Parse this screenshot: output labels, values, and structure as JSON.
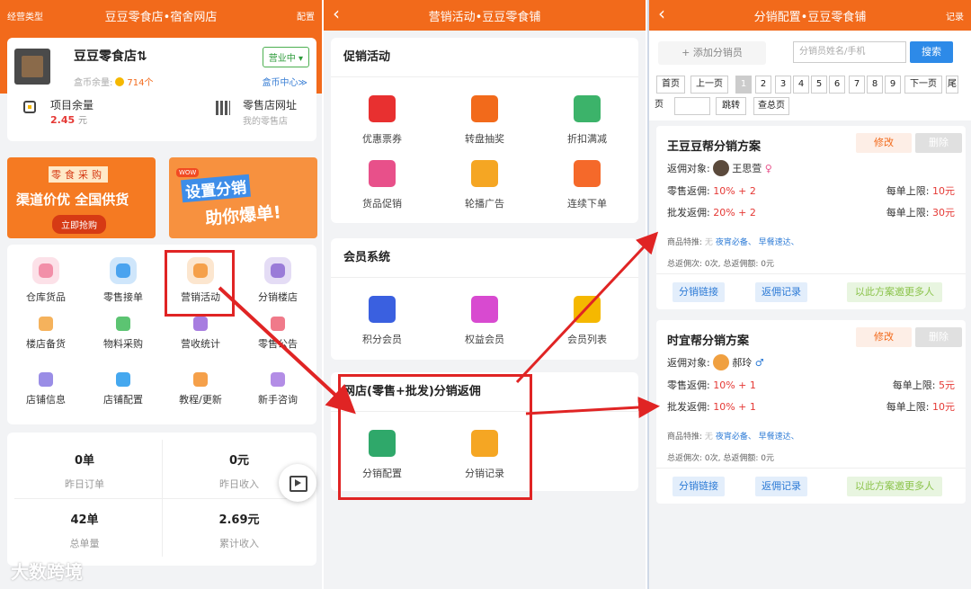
{
  "panel1": {
    "header": {
      "left": "经营类型",
      "title": "豆豆零食店•宿舍网店",
      "right": "配置"
    },
    "store": {
      "name": "豆豆零食店⇅",
      "status": "营业中 ▾",
      "coin_label": "盒币余量:",
      "coin_value": "714个",
      "coin_center": "盒币中心≫",
      "proj_label": "项目余量",
      "proj_value": "2.45",
      "proj_unit": "元",
      "url_label": "零售店网址",
      "url_sub": "我的零售店"
    },
    "banner1": {
      "tag": "零食采购",
      "big": "渠道价优 全国供货",
      "btn": "立即抢购"
    },
    "banner2": {
      "wow": "WOW",
      "line1": "设置分销",
      "line2": "助你爆单!"
    },
    "grid": [
      {
        "label": "仓库货品",
        "color": "#f28fa8"
      },
      {
        "label": "零售接单",
        "color": "#4aa3ef"
      },
      {
        "label": "营销活动",
        "color": "#f5a04a"
      },
      {
        "label": "分销楼店",
        "color": "#9a7bd8"
      },
      {
        "label": "楼店备货",
        "color": "#f5b25c"
      },
      {
        "label": "物料采购",
        "color": "#5cc472"
      },
      {
        "label": "营收统计",
        "color": "#a77de0"
      },
      {
        "label": "零售公告",
        "color": "#f07a8a"
      },
      {
        "label": "店铺信息",
        "color": "#9a8de6"
      },
      {
        "label": "店铺配置",
        "color": "#45a8ef"
      },
      {
        "label": "教程/更新",
        "color": "#f5a04a"
      },
      {
        "label": "新手咨询",
        "color": "#b38de6"
      }
    ],
    "stats": [
      {
        "value": "0单",
        "label": "昨日订单"
      },
      {
        "value": "0元",
        "label": "昨日收入"
      },
      {
        "value": "42单",
        "label": "总单量"
      },
      {
        "value": "2.69元",
        "label": "累计收入"
      }
    ],
    "watermark": "大数跨境"
  },
  "panel2": {
    "header": {
      "title": "营销活动•豆豆零食铺"
    },
    "sections": [
      {
        "title": "促销活动",
        "items": [
          {
            "label": "优惠票券",
            "color": "#e83030"
          },
          {
            "label": "转盘抽奖",
            "color": "#f26a1b"
          },
          {
            "label": "折扣满减",
            "color": "#3cb36a"
          },
          {
            "label": "货品促销",
            "color": "#e8508a"
          },
          {
            "label": "轮播广告",
            "color": "#f5a623"
          },
          {
            "label": "连续下单",
            "color": "#f5692a"
          }
        ]
      },
      {
        "title": "会员系统",
        "items": [
          {
            "label": "积分会员",
            "color": "#3a60e0"
          },
          {
            "label": "权益会员",
            "color": "#d84ad0"
          },
          {
            "label": "会员列表",
            "color": "#f5b800"
          }
        ]
      },
      {
        "title": "网店(零售+批发)分销返佣",
        "items": [
          {
            "label": "分销配置",
            "color": "#2fa86a"
          },
          {
            "label": "分销记录",
            "color": "#f5a623"
          }
        ]
      }
    ]
  },
  "panel3": {
    "header": {
      "title": "分销配置•豆豆零食铺",
      "right": "记录"
    },
    "add_btn": "+ 添加分销员",
    "search_placeholder": "分销员姓名/手机",
    "search_btn": "搜索",
    "pager": [
      "首页",
      "上一页",
      "1",
      "2",
      "3",
      "4",
      "5",
      "6",
      "7",
      "8",
      "9",
      "下一页",
      "尾"
    ],
    "pager2": [
      "页",
      "",
      "跳转",
      "查总页"
    ],
    "plans": [
      {
        "title": "王豆豆帮分销方案",
        "edit": "修改",
        "del": "删除",
        "target_label": "返佣对象:",
        "target_name": "王思萱",
        "gender": "♀",
        "retail_label": "零售返佣:",
        "retail_value": "10% + 2",
        "wholesale_label": "批发返佣:",
        "wholesale_value": "20% + 2",
        "limit_label": "每单上限:",
        "retail_limit": "10元",
        "wholesale_limit": "30元",
        "goods_label": "商品特推:",
        "goods_none": "无",
        "goods_tags": "夜宵必备、 早餐速达、",
        "summary": "总返佣次: 0次, 总返佣额: 0元",
        "actions": [
          "分销链接",
          "返佣记录",
          "以此方案邀更多人"
        ]
      },
      {
        "title": "时宜帮分销方案",
        "edit": "修改",
        "del": "删除",
        "target_label": "返佣对象:",
        "target_name": "郝玲",
        "gender": "♂",
        "retail_label": "零售返佣:",
        "retail_value": "10% + 1",
        "wholesale_label": "批发返佣:",
        "wholesale_value": "10% + 1",
        "limit_label": "每单上限:",
        "retail_limit": "5元",
        "wholesale_limit": "10元",
        "goods_label": "商品特推:",
        "goods_none": "无",
        "goods_tags": "夜宵必备、 早餐速达、",
        "summary": "总返佣次: 0次, 总返佣额: 0元",
        "actions": [
          "分销链接",
          "返佣记录",
          "以此方案邀更多人"
        ]
      }
    ]
  },
  "colors": {
    "brand": "#f26a1b",
    "highlight": "#e02424",
    "link": "#2d7bd6"
  }
}
